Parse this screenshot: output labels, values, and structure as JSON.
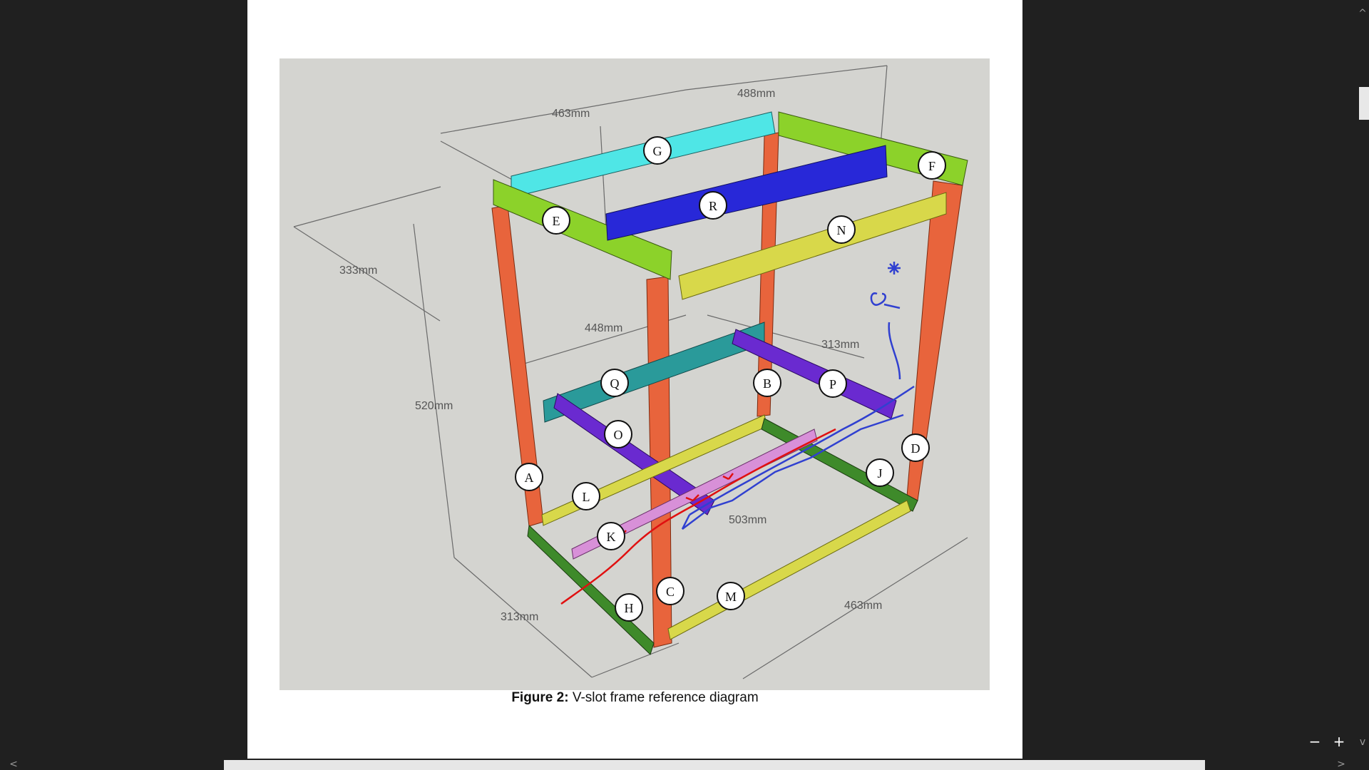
{
  "figure": {
    "caption_bold": "Figure 2:",
    "caption_text": " V-slot frame reference diagram",
    "dimensions": [
      "488mm",
      "463mm",
      "333mm",
      "448mm",
      "313mm",
      "520mm",
      "503mm",
      "313mm",
      "463mm"
    ],
    "part_labels": [
      "G",
      "F",
      "E",
      "R",
      "N",
      "Q",
      "B",
      "P",
      "O",
      "D",
      "A",
      "J",
      "L",
      "K",
      "C",
      "M",
      "H"
    ]
  },
  "controls": {
    "zoom_out": "−",
    "zoom_in": "+",
    "scroll_up": "^",
    "scroll_down": "v",
    "scroll_left": "<",
    "scroll_right": ">"
  },
  "colors": {
    "background": "#202020",
    "page": "#ffffff",
    "figure_bg": "#d4d4d0",
    "upright": "#e8643c",
    "cyan": "#4fe6e6",
    "blue": "#2828d8",
    "lime": "#8cd22a",
    "yellow": "#d8d84a",
    "teal": "#2a9a9a",
    "violet": "#6a2ad0",
    "green": "#3e8a2a",
    "pink": "#d890d8",
    "annotation_blue": "#3040d0",
    "annotation_red": "#e01010"
  }
}
